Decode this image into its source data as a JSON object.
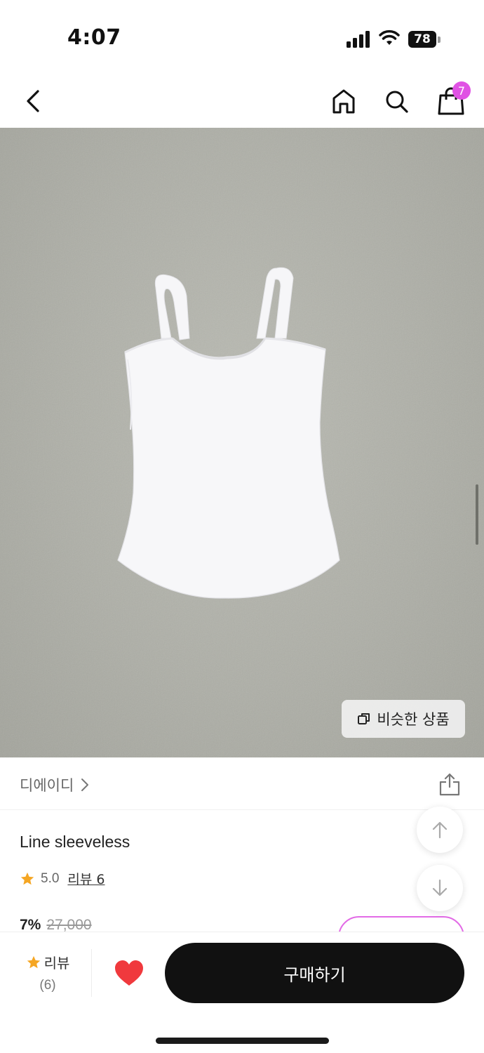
{
  "status_bar": {
    "time": "4:07",
    "battery_level": "78",
    "icons": [
      "signal-icon",
      "wifi-icon",
      "battery-icon"
    ]
  },
  "header": {
    "cart_count": "7",
    "icons": [
      "back-icon",
      "home-icon",
      "search-icon",
      "shopping-bag-icon"
    ]
  },
  "product_image": {
    "similar_button_label": "비슷한 상품",
    "icons": [
      "copy-icon"
    ]
  },
  "brand": {
    "name": "디에이디",
    "icons": [
      "chevron-right-icon",
      "share-icon"
    ]
  },
  "product": {
    "title": "Line sleeveless",
    "rating": "5.0",
    "review_link": "리뷰 6",
    "discount": "7%",
    "original_price": "27,000"
  },
  "floating": {
    "icons": [
      "arrow-up-icon",
      "arrow-down-icon"
    ]
  },
  "bottom_bar": {
    "review_label": "리뷰",
    "review_count": "(6)",
    "buy_label": "구매하기",
    "icons": [
      "star-icon",
      "heart-icon"
    ]
  },
  "colors": {
    "accent_pink": "#e052e4",
    "star": "#f5a623",
    "heart": "#f0393d",
    "buy_button": "#111111"
  }
}
